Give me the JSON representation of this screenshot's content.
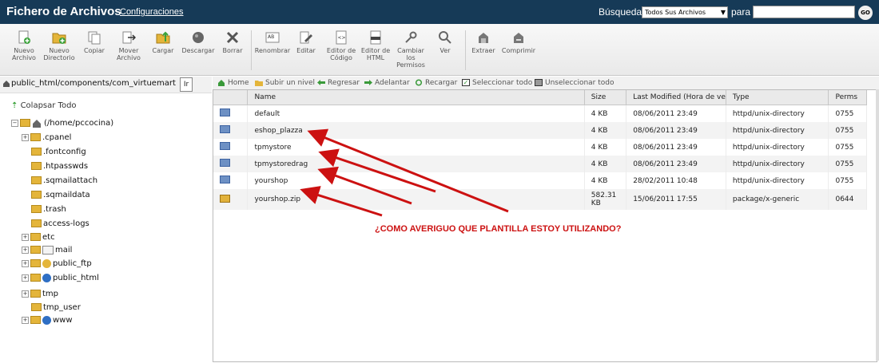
{
  "header": {
    "title": "Fichero de Archivos",
    "config_link": "Configuraciones",
    "search_label": "Búsqueda",
    "search_scope": "Todos Sus Archivos",
    "para_label": "para",
    "search_value": "",
    "go_label": "GO"
  },
  "toolbar": {
    "nuevo_archivo": "Nuevo Archivo",
    "nuevo_directorio": "Nuevo Directorio",
    "copiar": "Copiar",
    "mover_archivo": "Mover Archivo",
    "cargar": "Cargar",
    "descargar": "Descargar",
    "borrar": "Borrar",
    "renombrar": "Renombrar",
    "editar": "Editar",
    "editor_codigo": "Editor de Código",
    "editor_html": "Editor de HTML",
    "cambiar_permisos": "Cambiar los Permisos",
    "ver": "Ver",
    "extraer": "Extraer",
    "comprimir": "Comprimir"
  },
  "path": {
    "value": "public_html/components/com_virtuemart",
    "go_label": "Ir"
  },
  "tree": {
    "collapse_label": "Colapsar Todo",
    "root": "(/home/pccocina)",
    "items": [
      ".cpanel",
      ".fontconfig",
      ".htpasswds",
      ".sqmailattach",
      ".sqmaildata",
      ".trash",
      "access-logs",
      "etc",
      "mail",
      "public_ftp",
      "public_html",
      "tmp",
      "tmp_user",
      "www"
    ]
  },
  "nav": {
    "home": "Home",
    "up": "Subir un nivel",
    "back": "Regresar",
    "forward": "Adelantar",
    "reload": "Recargar",
    "select_all": "Seleccionar todo",
    "deselect_all": "Unseleccionar todo"
  },
  "table": {
    "columns": [
      "Name",
      "Size",
      "Last Modified (Hora de ve",
      "Type",
      "Perms"
    ],
    "rows": [
      {
        "name": "default",
        "size": "4 KB",
        "modified": "08/06/2011 23:49",
        "type": "httpd/unix-directory",
        "perms": "0755"
      },
      {
        "name": "eshop_plazza",
        "size": "4 KB",
        "modified": "08/06/2011 23:49",
        "type": "httpd/unix-directory",
        "perms": "0755"
      },
      {
        "name": "tpmystore",
        "size": "4 KB",
        "modified": "08/06/2011 23:49",
        "type": "httpd/unix-directory",
        "perms": "0755"
      },
      {
        "name": "tpmystoredrag",
        "size": "4 KB",
        "modified": "08/06/2011 23:49",
        "type": "httpd/unix-directory",
        "perms": "0755"
      },
      {
        "name": "yourshop",
        "size": "4 KB",
        "modified": "28/02/2011 10:48",
        "type": "httpd/unix-directory",
        "perms": "0755"
      },
      {
        "name": "yourshop.zip",
        "size_line1": "582.31",
        "size_line2": "KB",
        "modified": "15/06/2011 17:55",
        "type": "package/x-generic",
        "perms": "0644"
      }
    ]
  },
  "annotation": {
    "text": "¿COMO AVERIGUO QUE PLANTILLA ESTOY UTILIZANDO?",
    "color": "#cc1111"
  },
  "colors": {
    "header_bg": "#163a57",
    "folder_blue": "#6d90c4",
    "folder_yellow": "#e4b53a"
  }
}
